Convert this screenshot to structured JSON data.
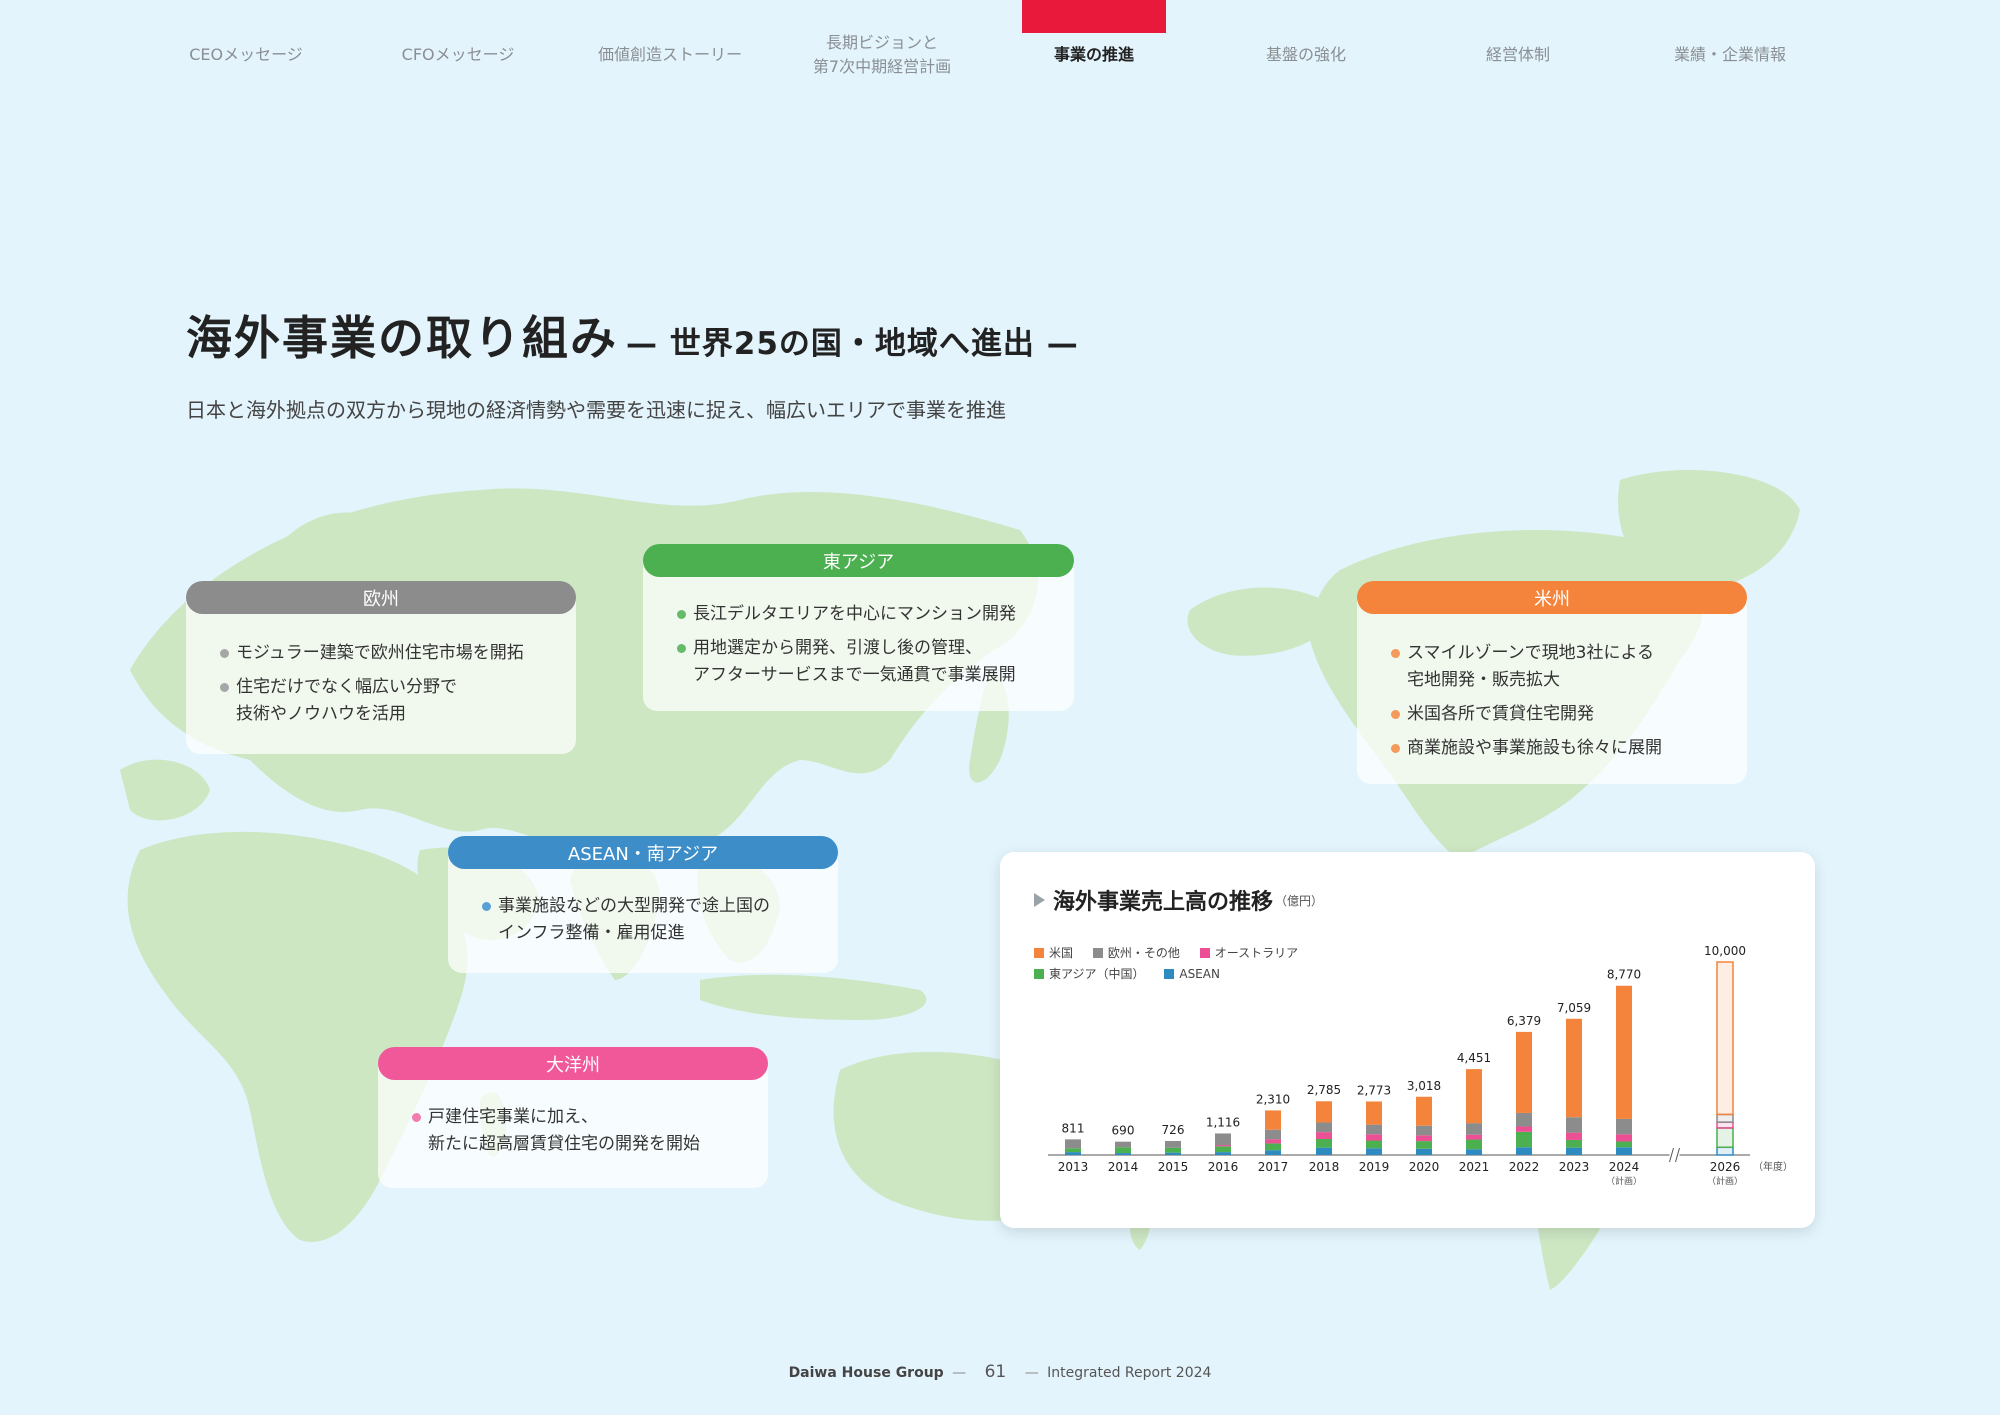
{
  "nav": {
    "items": [
      {
        "label": "CEOメッセージ"
      },
      {
        "label": "CFOメッセージ"
      },
      {
        "label": "価値創造ストーリー"
      },
      {
        "label": "長期ビジョンと\n第7次中期経営計画"
      },
      {
        "label": "事業の推進"
      },
      {
        "label": "基盤の強化"
      },
      {
        "label": "経営体制"
      },
      {
        "label": "業績・企業情報"
      }
    ],
    "active_index": 4,
    "accent_color": "#e8193a"
  },
  "header": {
    "title": "海外事業の取り組み",
    "subtitle": "— 世界25の国・地域へ進出 —",
    "lead": "日本と海外拠点の双方から現地の経済情勢や需要を迅速に捉え、幅広いエリアで事業を推進"
  },
  "regions": [
    {
      "key": "europe",
      "title": "欧州",
      "color": "#8c8c8c",
      "dot_color": "#a6a6a6",
      "bullets": [
        "モジュラー建築で欧州住宅市場を開拓",
        "住宅だけでなく幅広い分野で\n技術やノウハウを活用"
      ]
    },
    {
      "key": "east-asia",
      "title": "東アジア",
      "color": "#4caf50",
      "dot_color": "#66bb6a",
      "bullets": [
        "長江デルタエリアを中心にマンション開発",
        "用地選定から開発、引渡し後の管理、\nアフターサービスまで一気通貫で事業展開"
      ]
    },
    {
      "key": "usa",
      "title": "米州",
      "color": "#f4843c",
      "dot_color": "#f59a5a",
      "bullets": [
        "スマイルゾーンで現地3社による\n宅地開発・販売拡大",
        "米国各所で賃貸住宅開発",
        "商業施設や事業施設も徐々に展開"
      ]
    },
    {
      "key": "asean",
      "title": "ASEAN・南アジア",
      "color": "#3c8dc8",
      "dot_color": "#5aa0d6",
      "bullets": [
        "事業施設などの大型開発で途上国の\nインフラ整備・雇用促進"
      ]
    },
    {
      "key": "oceania",
      "title": "大洋州",
      "color": "#f0589a",
      "dot_color": "#f27bb0",
      "bullets": [
        "戸建住宅事業に加え、\n新たに超高層賃貸住宅の開発を開始"
      ]
    }
  ],
  "chart_data": {
    "type": "bar",
    "title": "海外事業売上高の推移",
    "unit": "（億円）",
    "xlabel": "（年度）",
    "categories": [
      "2013",
      "2014",
      "2015",
      "2016",
      "2017",
      "2018",
      "2019",
      "2020",
      "2021",
      "2022",
      "2023",
      "2024",
      "2026"
    ],
    "category_notes": [
      "",
      "",
      "",
      "",
      "",
      "",
      "",
      "",
      "",
      "",
      "",
      "（計画）",
      "（計画）"
    ],
    "totals": [
      811,
      690,
      726,
      1116,
      2310,
      2785,
      2773,
      3018,
      4451,
      6379,
      7059,
      8770,
      10000
    ],
    "total_labels": [
      "811",
      "690",
      "726",
      "1,116",
      "2,310",
      "2,785",
      "2,773",
      "3,018",
      "4,451",
      "6,379",
      "7,059",
      "8,770",
      "10,000"
    ],
    "legend": [
      {
        "name": "米国",
        "color": "#f4843c"
      },
      {
        "name": "欧州・その他",
        "color": "#8c8c8c"
      },
      {
        "name": "オーストラリア",
        "color": "#ec4f93"
      },
      {
        "name": "東アジア（中国）",
        "color": "#4caf50"
      },
      {
        "name": "ASEAN",
        "color": "#2e8bc0"
      }
    ],
    "series": [
      {
        "name": "ASEAN",
        "color": "#2e8bc0",
        "values": [
          150,
          100,
          120,
          150,
          250,
          380,
          350,
          320,
          300,
          400,
          380,
          400,
          400
        ]
      },
      {
        "name": "東アジア（中国）",
        "color": "#4caf50",
        "values": [
          200,
          300,
          250,
          300,
          350,
          450,
          400,
          400,
          500,
          800,
          400,
          300,
          1000
        ]
      },
      {
        "name": "オーストラリア",
        "color": "#ec4f93",
        "values": [
          0,
          0,
          0,
          66,
          210,
          355,
          323,
          298,
          251,
          279,
          379,
          370,
          300
        ]
      },
      {
        "name": "欧州・その他",
        "color": "#8c8c8c",
        "values": [
          461,
          290,
          356,
          600,
          500,
          500,
          500,
          500,
          600,
          700,
          800,
          800,
          400
        ]
      },
      {
        "name": "米国",
        "color": "#f4843c",
        "values": [
          0,
          0,
          0,
          0,
          1000,
          1100,
          1200,
          1500,
          2800,
          4200,
          5100,
          6900,
          7900
        ]
      }
    ],
    "ylim": [
      0,
      10000
    ],
    "planned_index": 12,
    "axis_break_after_index": 11
  },
  "footer": {
    "brand": "Daiwa House Group",
    "page": "61",
    "report": "Integrated Report 2024"
  }
}
